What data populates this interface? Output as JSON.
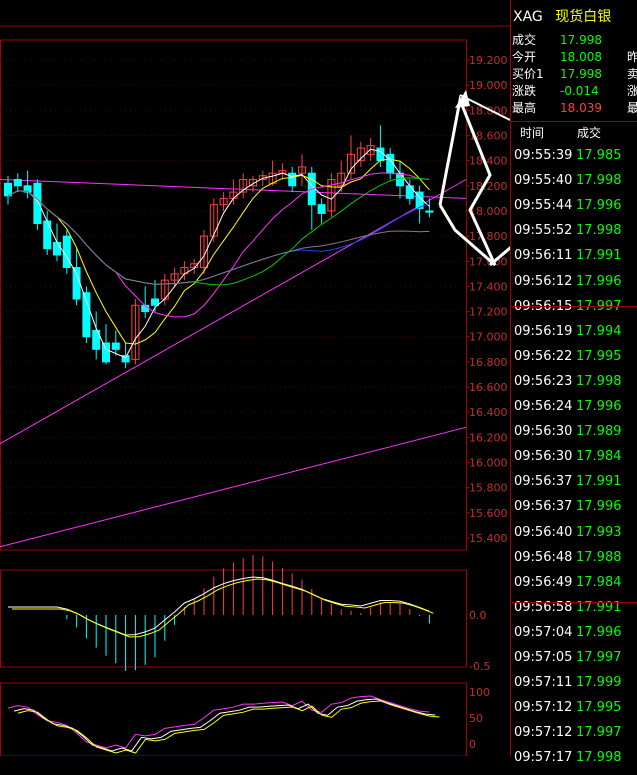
{
  "chart_data": {
    "type": "candlestick",
    "y_ticks": [
      "19.200",
      "19.000",
      "18.800",
      "18.600",
      "18.400",
      "18.200",
      "18.000",
      "17.800",
      "17.600",
      "17.400",
      "17.200",
      "17.000",
      "16.800",
      "16.600",
      "16.400",
      "16.200",
      "16.000",
      "15.800",
      "15.600",
      "15.400"
    ],
    "ylim": [
      15.4,
      19.2
    ],
    "candles": [
      [
        18.22,
        18.28,
        18.12,
        18.05
      ],
      [
        18.25,
        18.3,
        18.2,
        18.15
      ],
      [
        18.2,
        18.32,
        18.15,
        18.1
      ],
      [
        18.22,
        18.25,
        17.9,
        17.85
      ],
      [
        17.92,
        18.0,
        17.7,
        17.65
      ],
      [
        17.75,
        17.9,
        17.65,
        17.6
      ],
      [
        17.8,
        17.85,
        17.55,
        17.5
      ],
      [
        17.55,
        17.7,
        17.3,
        17.25
      ],
      [
        17.35,
        17.4,
        17.0,
        16.95
      ],
      [
        17.05,
        17.2,
        16.9,
        16.82
      ],
      [
        16.95,
        17.1,
        16.8,
        16.78
      ],
      [
        16.95,
        17.05,
        16.9,
        16.85
      ],
      [
        16.85,
        16.95,
        16.8,
        16.75
      ],
      [
        16.82,
        17.3,
        17.25,
        16.78
      ],
      [
        17.25,
        17.4,
        17.2,
        17.15
      ],
      [
        17.3,
        17.45,
        17.25,
        17.2
      ],
      [
        17.3,
        17.5,
        17.45,
        17.25
      ],
      [
        17.45,
        17.55,
        17.5,
        17.4
      ],
      [
        17.5,
        17.6,
        17.55,
        17.45
      ],
      [
        17.55,
        17.62,
        17.58,
        17.5
      ],
      [
        17.55,
        17.85,
        17.8,
        17.5
      ],
      [
        17.8,
        18.1,
        18.05,
        17.75
      ],
      [
        18.05,
        18.15,
        18.1,
        18.0
      ],
      [
        18.1,
        18.25,
        18.15,
        18.05
      ],
      [
        18.15,
        18.3,
        18.25,
        18.1
      ],
      [
        18.2,
        18.28,
        18.25,
        18.15
      ],
      [
        18.25,
        18.32,
        18.28,
        18.2
      ],
      [
        18.22,
        18.4,
        18.3,
        18.2
      ],
      [
        18.3,
        18.38,
        18.32,
        18.25
      ],
      [
        18.3,
        18.35,
        18.2,
        18.15
      ],
      [
        18.3,
        18.45,
        18.35,
        18.2
      ],
      [
        18.3,
        18.35,
        18.05,
        17.85
      ],
      [
        18.05,
        18.1,
        17.98,
        17.9
      ],
      [
        18.0,
        18.3,
        18.25,
        17.95
      ],
      [
        18.2,
        18.4,
        18.3,
        18.15
      ],
      [
        18.3,
        18.6,
        18.45,
        18.25
      ],
      [
        18.4,
        18.55,
        18.5,
        18.35
      ],
      [
        18.45,
        18.58,
        18.52,
        18.4
      ],
      [
        18.5,
        18.68,
        18.4,
        18.35
      ],
      [
        18.45,
        18.5,
        18.3,
        18.25
      ],
      [
        18.3,
        18.4,
        18.2,
        18.1
      ],
      [
        18.2,
        18.25,
        18.1,
        18.05
      ],
      [
        18.15,
        18.2,
        18.02,
        17.9
      ],
      [
        18.0,
        18.1,
        17.99,
        17.95
      ]
    ],
    "sub_y_ticks_1": [
      "0.0",
      "-0.5"
    ],
    "sub_y_ticks_2": [
      "100",
      "50",
      "0"
    ]
  },
  "quote": {
    "symbol": "XAG",
    "name": "现货白银",
    "rows": [
      {
        "label": "成交",
        "value": "17.998",
        "color": "#00ff00",
        "extra": ""
      },
      {
        "label": "今开",
        "value": "18.008",
        "color": "#00ff00",
        "extra": "昨"
      },
      {
        "label": "买价1",
        "value": "17.998",
        "color": "#00ff00",
        "extra": "卖"
      },
      {
        "label": "涨跌",
        "value": "-0.014",
        "color": "#00ff00",
        "extra": "涨"
      },
      {
        "label": "最高",
        "value": "18.039",
        "color": "#ff4040",
        "extra": "最"
      }
    ]
  },
  "ticks_header": {
    "time": "时间",
    "price": "成交"
  },
  "ticks": [
    {
      "time": "09:55:39",
      "price": "17.985"
    },
    {
      "time": "09:55:40",
      "price": "17.998"
    },
    {
      "time": "09:55:44",
      "price": "17.996"
    },
    {
      "time": "09:55:52",
      "price": "17.998"
    },
    {
      "time": "09:56:11",
      "price": "17.991"
    },
    {
      "time": "09:56:12",
      "price": "17.996"
    },
    {
      "time": "09:56:15",
      "price": "17.997"
    },
    {
      "time": "09:56:19",
      "price": "17.994"
    },
    {
      "time": "09:56:22",
      "price": "17.995"
    },
    {
      "time": "09:56:23",
      "price": "17.998"
    },
    {
      "time": "09:56:24",
      "price": "17.996"
    },
    {
      "time": "09:56:30",
      "price": "17.989"
    },
    {
      "time": "09:56:30",
      "price": "17.984"
    },
    {
      "time": "09:56:37",
      "price": "17.991"
    },
    {
      "time": "09:56:37",
      "price": "17.996"
    },
    {
      "time": "09:56:40",
      "price": "17.993"
    },
    {
      "time": "09:56:48",
      "price": "17.988"
    },
    {
      "time": "09:56:49",
      "price": "17.984"
    },
    {
      "time": "09:56:58",
      "price": "17.991"
    },
    {
      "time": "09:57:04",
      "price": "17.996"
    },
    {
      "time": "09:57:05",
      "price": "17.997"
    },
    {
      "time": "09:57:11",
      "price": "17.999"
    },
    {
      "time": "09:57:12",
      "price": "17.995"
    },
    {
      "time": "09:57:12",
      "price": "17.997"
    },
    {
      "time": "09:57:17",
      "price": "17.998"
    }
  ]
}
